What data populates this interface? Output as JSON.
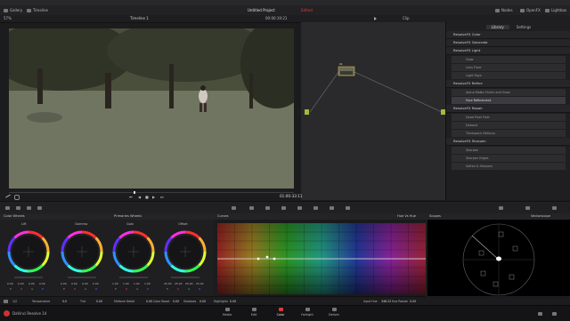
{
  "menu": {
    "items": [
      "DaVinci Resolve",
      "File",
      "Edit",
      "Trim",
      "Timeline",
      "Clip",
      "Mark",
      "View",
      "Playback",
      "Fusion",
      "Color",
      "Fairlight",
      "Workspace",
      "Help"
    ]
  },
  "topbar": {
    "gallery": "Gallery",
    "timeline": "Timeline",
    "project_title": "Untitled Project",
    "project_status": "Edited",
    "nodes": "Nodes",
    "openfx": "OpenFX",
    "lightbox": "Lightbox"
  },
  "viewer": {
    "zoom": "57%",
    "timeline_name": "Timeline 1",
    "timecode_top": "00:00:19:21",
    "clip_label": "Clip",
    "timecode": "01:00:33:11"
  },
  "node": {
    "label": "01"
  },
  "library": {
    "tab_library": "Library",
    "tab_settings": "Settings",
    "top_title": "ResolveFX Color",
    "sections": [
      {
        "title": "ResolveFX Color",
        "items": []
      },
      {
        "title": "ResolveFX Generate",
        "items": []
      },
      {
        "title": "ResolveFX Light",
        "items": [
          "Glow",
          "Lens Flare",
          "Light Rays"
        ]
      },
      {
        "title": "ResolveFX Refine",
        "items": [
          "Alpha Matte Shrink and Grow",
          "Face Refinement"
        ]
      },
      {
        "title": "ResolveFX Repair",
        "items": [
          "Dead Pixel Fixer",
          "Deband",
          "Timespace Defocus"
        ]
      },
      {
        "title": "ResolveFX Sharpen",
        "items": [
          "Sharpen",
          "Sharpen Edges",
          "Soften & Sharpen"
        ]
      }
    ],
    "selected_item": "Face Refinement"
  },
  "panels": {
    "color_wheels": "Color Wheels",
    "primaries_wheels": "Primaries Wheels",
    "curves": "Curves",
    "hue_vs_hue": "Hue Vs Hue",
    "scopes": "Scopes",
    "vectorscope": "Vectorscope"
  },
  "wheels": [
    {
      "name": "Lift",
      "values": [
        "0.00",
        "0.00",
        "0.00",
        "0.00"
      ]
    },
    {
      "name": "Gamma",
      "values": [
        "0.00",
        "0.00",
        "0.00",
        "0.00"
      ]
    },
    {
      "name": "Gain",
      "values": [
        "1.00",
        "1.00",
        "1.00",
        "1.00"
      ]
    },
    {
      "name": "Offset",
      "values": [
        "25.00",
        "25.00",
        "25.00",
        "25.00"
      ]
    }
  ],
  "wheel_channels": [
    "Y",
    "R",
    "G",
    "B"
  ],
  "wheel_colors": [
    "#d6d6d6",
    "#e04040",
    "#40c040",
    "#4060ff"
  ],
  "bottom_params": [
    {
      "label": "Temperature",
      "value": "0.0"
    },
    {
      "label": "Tint",
      "value": "0.00"
    },
    {
      "label": "Midtone Detail",
      "value": "0.00"
    },
    {
      "label": "Color Boost",
      "value": "0.00"
    },
    {
      "label": "Shadows",
      "value": "0.00"
    },
    {
      "label": "Highlights",
      "value": "0.00"
    }
  ],
  "curve_params": [
    {
      "label": "Input Hue",
      "value": "348.22"
    },
    {
      "label": "Hue Rotate",
      "value": "0.00"
    }
  ],
  "pages": [
    {
      "label": "Media",
      "active": false
    },
    {
      "label": "Edit",
      "active": false
    },
    {
      "label": "Color",
      "active": true
    },
    {
      "label": "Fairlight",
      "active": false
    },
    {
      "label": "Deliver",
      "active": false
    }
  ],
  "app_name": "DaVinci Resolve 14",
  "colors": {
    "accent": "#e0393e",
    "node_green": "#9dbd3a"
  }
}
